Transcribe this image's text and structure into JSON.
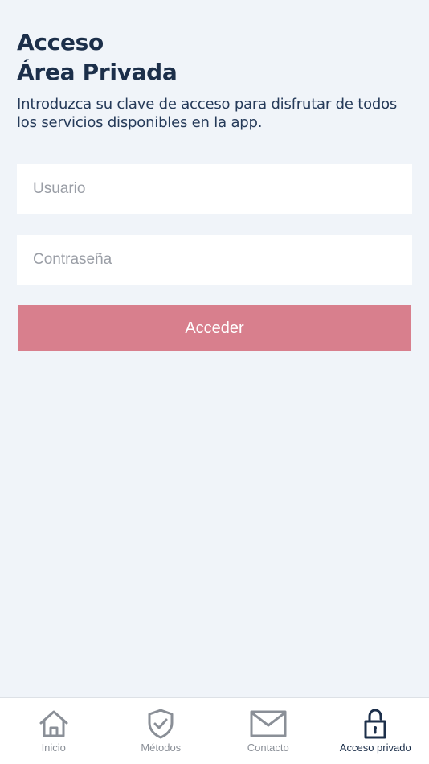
{
  "header": {
    "title_line1": "Acceso",
    "title_line2": "Área Privada",
    "subtitle": "Introduzca su clave de acceso para disfrutar de todos los servicios disponibles en la app."
  },
  "form": {
    "username_placeholder": "Usuario",
    "password_placeholder": "Contraseña",
    "submit_label": "Acceder",
    "submit_color": "#d87f8d"
  },
  "tabs": [
    {
      "label": "Inicio",
      "icon": "home-icon",
      "active": false
    },
    {
      "label": "Métodos",
      "icon": "shield-check-icon",
      "active": false
    },
    {
      "label": "Contacto",
      "icon": "mail-icon",
      "active": false
    },
    {
      "label": "Acceso privado",
      "icon": "lock-icon",
      "active": true
    }
  ],
  "colors": {
    "background": "#f0f4f9",
    "text_primary": "#1c2f4a",
    "tab_inactive": "#8a8f97",
    "tab_active": "#1c2f4a"
  }
}
